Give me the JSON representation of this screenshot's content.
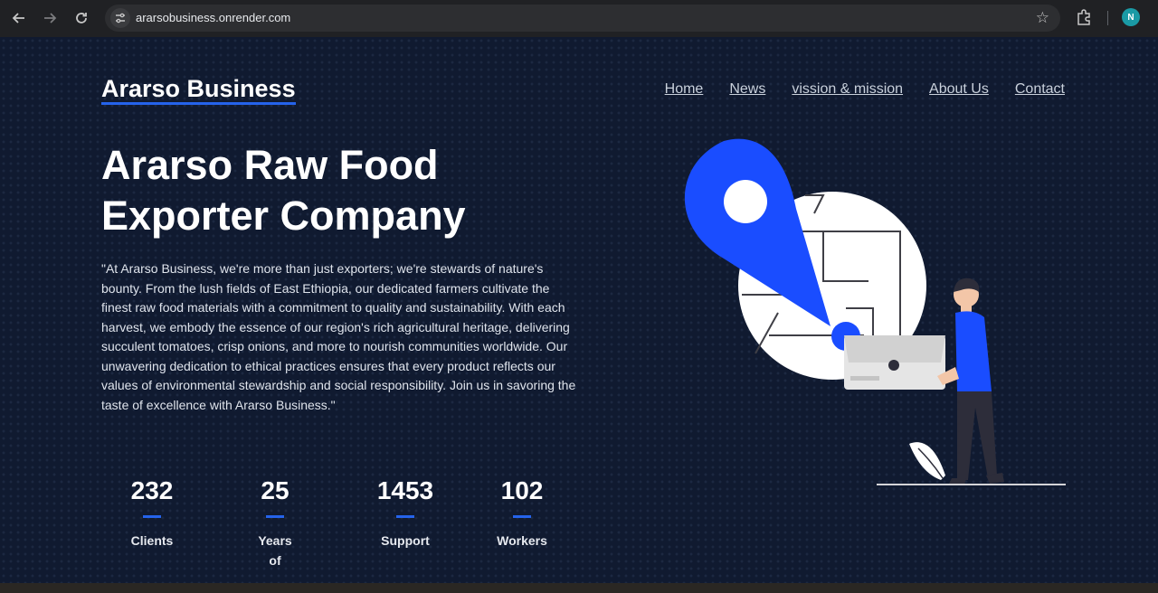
{
  "browser": {
    "url": "ararsobusiness.onrender.com",
    "profile_initial": "N"
  },
  "site": {
    "brand": "Ararso Business",
    "nav": [
      "Home",
      "News",
      "vission & mission",
      "About Us",
      "Contact"
    ],
    "headline_line1": "Ararso Raw Food",
    "headline_line2": "Exporter Company",
    "paragraph": "\"At Ararso Business, we're more than just exporters; we're stewards of nature's bounty. From the lush fields of East Ethiopia, our dedicated farmers cultivate the finest raw food materials with a commitment to quality and sustainability. With each harvest, we embody the essence of our region's rich agricultural heritage, delivering succulent tomatoes, crisp onions, and more to nourish communities worldwide. Our unwavering dedication to ethical practices ensures that every product reflects our values of environmental stewardship and social responsibility. Join us in savoring the taste of excellence with Ararso Business.\"",
    "stats": [
      {
        "value": "232",
        "label": "Clients"
      },
      {
        "value": "25",
        "label": "Years of"
      },
      {
        "value": "1453",
        "label": "Support"
      },
      {
        "value": "102",
        "label": "Workers"
      }
    ]
  },
  "colors": {
    "background": "#101a30",
    "accent": "#2563eb",
    "pin": "#1a4dff"
  }
}
